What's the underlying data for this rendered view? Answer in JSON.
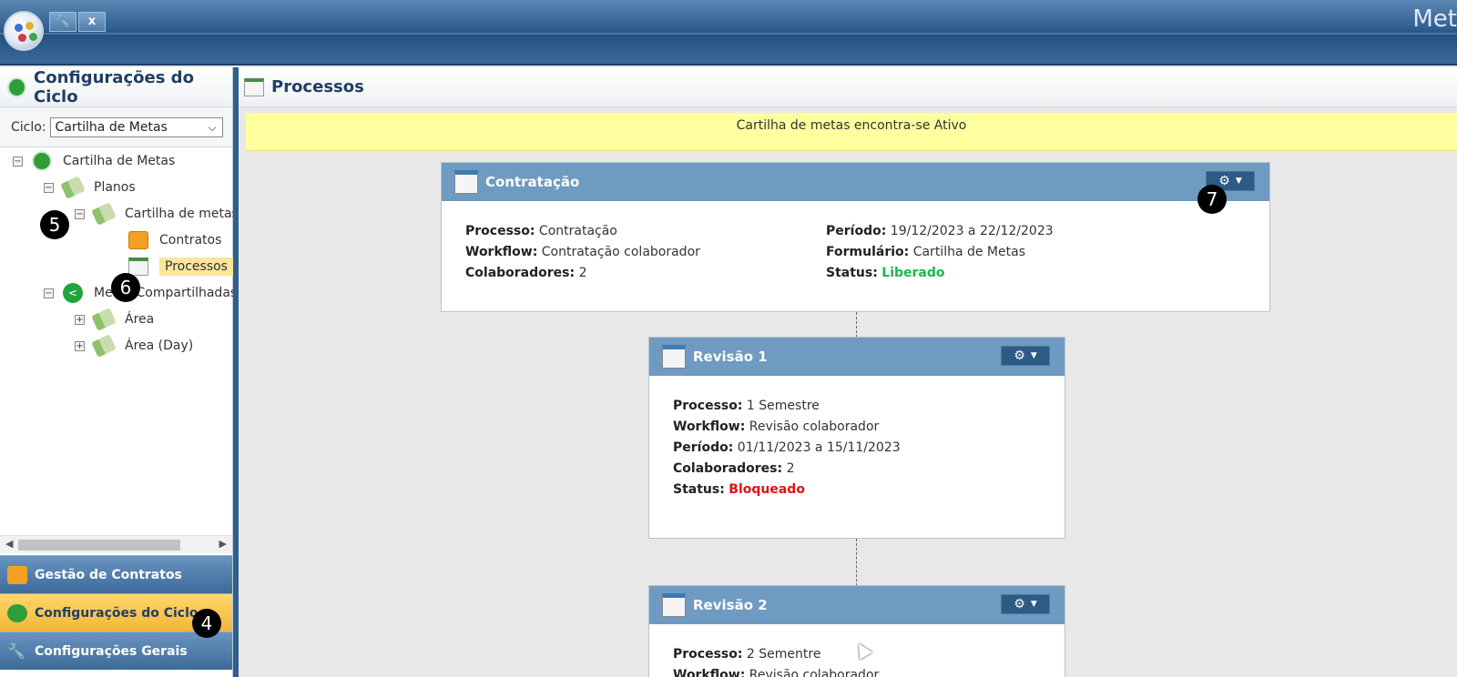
{
  "topbar": {
    "tool_icon": "wrench-icon",
    "close_label": "x",
    "brand_text": "Met"
  },
  "left_panel": {
    "title": "Configurações do Ciclo",
    "cycle_label": "Ciclo:",
    "cycle_value": "Cartilha de Metas",
    "tree": {
      "root": "Cartilha de Metas",
      "planos": "Planos",
      "plan_item": "Cartilha de metas",
      "contratos": "Contratos",
      "processos": "Processos",
      "metas_compartilhadas": "Metas Compartilhadas",
      "area": "Área",
      "area_day": "Área (Day)"
    },
    "accordion": {
      "gestao": "Gestão de Contratos",
      "config_ciclo": "Configurações do Ciclo",
      "config_gerais": "Configurações Gerais"
    }
  },
  "main": {
    "title": "Processos",
    "banner": "Cartilha de metas encontra-se Ativo",
    "cards": [
      {
        "title": "Contratação",
        "processo_label": "Processo:",
        "processo": "Contratação",
        "workflow_label": "Workflow:",
        "workflow": "Contratação colaborador",
        "colaboradores_label": "Colaboradores:",
        "colaboradores": "2",
        "periodo_label": "Período:",
        "periodo": "19/12/2023 a 22/12/2023",
        "formulario_label": "Formulário:",
        "formulario": "Cartilha de Metas",
        "status_label": "Status:",
        "status": "Liberado"
      },
      {
        "title": "Revisão 1",
        "processo_label": "Processo:",
        "processo": "1 Semestre",
        "workflow_label": "Workflow:",
        "workflow": "Revisão colaborador",
        "periodo_label": "Período:",
        "periodo": "01/11/2023 a 15/11/2023",
        "colaboradores_label": "Colaboradores:",
        "colaboradores": "2",
        "status_label": "Status:",
        "status": "Bloqueado"
      },
      {
        "title": "Revisão 2",
        "processo_label": "Processo:",
        "processo": "2 Sementre",
        "workflow_label": "Workflow:",
        "workflow": "Revisão colaborador"
      }
    ]
  },
  "badges": [
    "4",
    "5",
    "6",
    "7"
  ],
  "colors": {
    "header_blue": "#2f5f8f",
    "card_head": "#6f9ac1",
    "status_green": "#19b94a",
    "status_red": "#e21010",
    "banner_yellow": "#ffff9f",
    "active_orange": "#f4b53b"
  }
}
